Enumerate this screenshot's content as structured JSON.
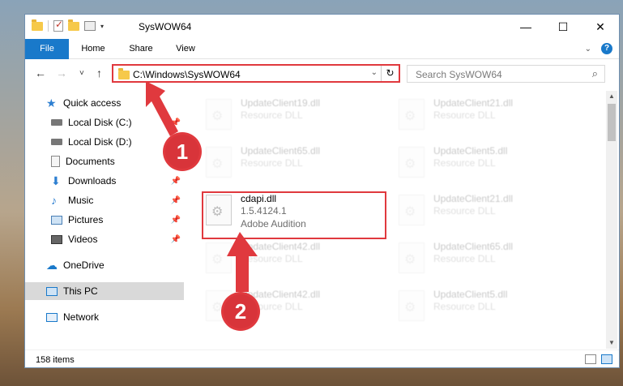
{
  "window": {
    "title": "SysWOW64",
    "controls": {
      "minimize": "—",
      "maximize": "☐",
      "close": "✕"
    }
  },
  "ribbon": {
    "tabs": [
      "File",
      "Home",
      "Share",
      "View"
    ],
    "expand_icon": "chevron-down-icon",
    "help_label": "?"
  },
  "nav": {
    "back": "←",
    "forward": "→",
    "recent": "˅",
    "up": "↑"
  },
  "address": {
    "path": "C:\\Windows\\SysWOW64",
    "dropdown": "⌄",
    "refresh": "↻"
  },
  "search": {
    "placeholder": "Search SysWOW64",
    "icon": "⌕"
  },
  "sidebar": {
    "items": [
      {
        "label": "Quick access",
        "icon": "star-icon",
        "pinned": false
      },
      {
        "label": "Local Disk (C:)",
        "icon": "drive-icon",
        "pinned": true
      },
      {
        "label": "Local Disk (D:)",
        "icon": "drive-icon",
        "pinned": true
      },
      {
        "label": "Documents",
        "icon": "documents-icon",
        "pinned": true
      },
      {
        "label": "Downloads",
        "icon": "download-icon",
        "pinned": true
      },
      {
        "label": "Music",
        "icon": "music-icon",
        "pinned": true
      },
      {
        "label": "Pictures",
        "icon": "pictures-icon",
        "pinned": true
      },
      {
        "label": "Videos",
        "icon": "videos-icon",
        "pinned": true
      },
      {
        "label": "OneDrive",
        "icon": "cloud-icon",
        "pinned": false
      },
      {
        "label": "This PC",
        "icon": "computer-icon",
        "pinned": false,
        "selected": true
      },
      {
        "label": "Network",
        "icon": "network-icon",
        "pinned": false
      }
    ]
  },
  "files": [
    {
      "name": "UpdateClient19.dll",
      "line2": "Resource DLL",
      "line3": ""
    },
    {
      "name": "UpdateClient21.dll",
      "line2": "Resource DLL",
      "line3": ""
    },
    {
      "name": "UpdateClient65.dll",
      "line2": "Resource DLL",
      "line3": ""
    },
    {
      "name": "UpdateClient5.dll",
      "line2": "Resource DLL",
      "line3": ""
    },
    {
      "name": "cdapi.dll",
      "line2": "1.5.4124.1",
      "line3": "Adobe Audition"
    },
    {
      "name": "UpdateClient21.dll",
      "line2": "Resource DLL",
      "line3": ""
    },
    {
      "name": "UpdateClient42.dll",
      "line2": "Resource DLL",
      "line3": ""
    },
    {
      "name": "UpdateClient65.dll",
      "line2": "Resource DLL",
      "line3": ""
    },
    {
      "name": "UpdateClient42.dll",
      "line2": "Resource DLL",
      "line3": ""
    },
    {
      "name": "UpdateClient5.dll",
      "line2": "Resource DLL",
      "line3": ""
    }
  ],
  "status": {
    "item_count": "158 items"
  },
  "annotations": {
    "step1": "1",
    "step2": "2",
    "color": "#e0393e"
  }
}
